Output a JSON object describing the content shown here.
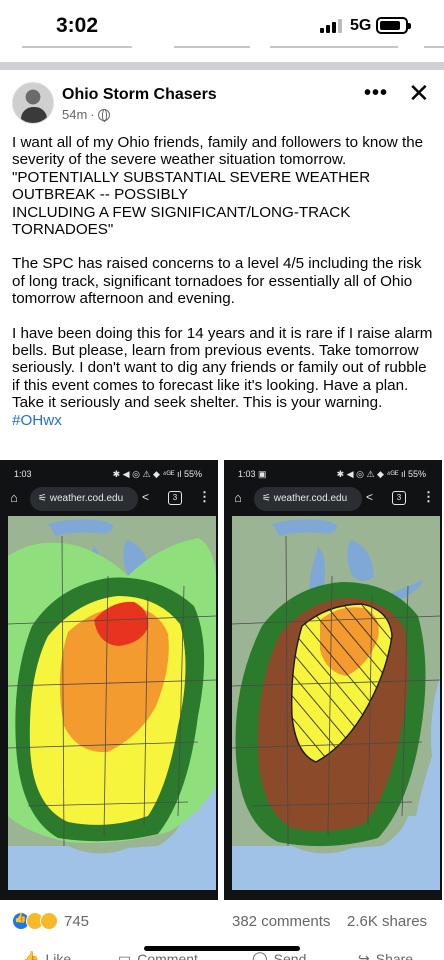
{
  "status_bar": {
    "time": "3:02",
    "network": "5G"
  },
  "post": {
    "page_name": "Ohio Storm Chasers",
    "timestamp": "54m",
    "separator": "·",
    "more_label": "•••",
    "close_label": "✕",
    "paragraphs": [
      "I want all of my Ohio friends, family and followers to know the severity of the severe weather situation tomorrow. \"POTENTIALLY SUBSTANTIAL SEVERE WEATHER OUTBREAK -- POSSIBLY\nINCLUDING A FEW SIGNIFICANT/LONG-TRACK TORNADOES\"",
      "The SPC has raised concerns to a level 4/5 including the risk of long track, significant tornadoes for essentially all of Ohio tomorrow afternoon and evening.",
      "I have been doing this for 14 years and it is rare if I raise alarm bells. But please, learn from previous events. Take tomorrow seriously. I don't want to dig any friends or family out of rubble if this event comes to forecast like it's looking. Have a plan. Take it seriously and seek shelter. This is your warning. "
    ],
    "hashtag": "#OHwx"
  },
  "images": [
    {
      "time": "1:03",
      "status_icons": "✱ ◀ ◎ ⚠ ◆ ⁴ᴳᴱ ıl 55%",
      "url": "weather.cod.edu",
      "tab_count": "3"
    },
    {
      "time": "1:03 ▣",
      "status_icons": "✱ ◀ ◎ ⚠ ◆ ⁴ᴳᴱ ıl 55%",
      "url": "weather.cod.edu",
      "tab_count": "3"
    }
  ],
  "stats": {
    "reaction_count": "745",
    "comments": "382 comments",
    "shares": "2.6K shares"
  },
  "actions": {
    "like": "Like",
    "comment": "Comment",
    "send": "Send",
    "share": "Share"
  },
  "colors": {
    "outlook_marginal": "#2c7a2c",
    "outlook_slight": "#f6f43c",
    "outlook_enhanced": "#f39b2e",
    "outlook_moderate": "#e8341f",
    "tstm_light_green": "#8fe07c",
    "tornado_brown": "#8b4a2a",
    "ocean": "#9fc2e6",
    "hashtag": "#216fdb"
  }
}
